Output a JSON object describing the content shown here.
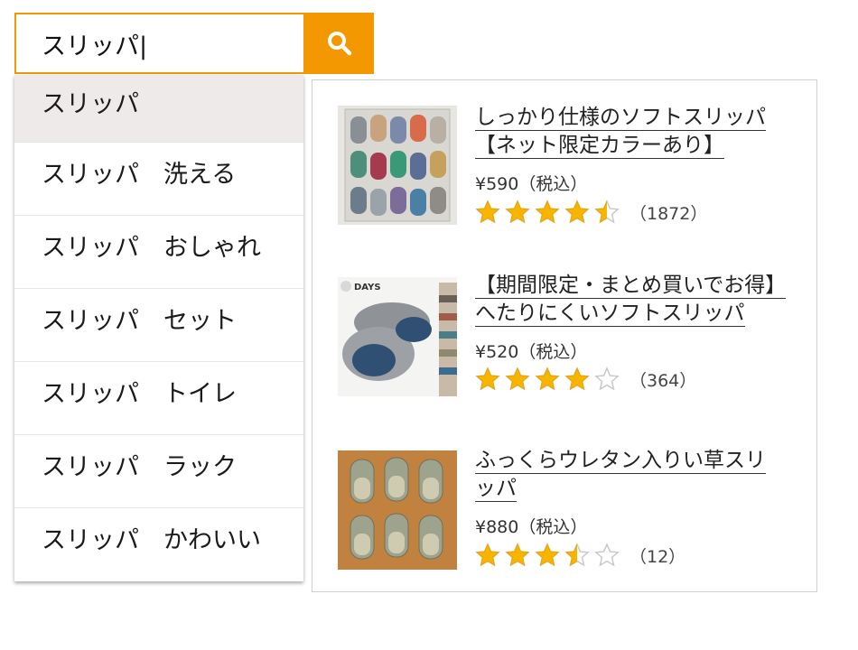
{
  "search": {
    "value": "スリッパ|",
    "icon": "search-icon",
    "accent_color": "#f39800"
  },
  "suggestions": [
    "スリッパ",
    "スリッパ　洗える",
    "スリッパ　おしゃれ",
    "スリッパ　セット",
    "スリッパ　トイレ",
    "スリッパ　ラック",
    "スリッパ　かわいい"
  ],
  "products": [
    {
      "name_line1": "しっかり仕様のソフトスリッパ",
      "name_line2": "【ネット限定カラーあり】",
      "price": "¥590（税込）",
      "rating": 4.5,
      "review_count": "（1872）",
      "thumb_icon": "slipper-rack-image"
    },
    {
      "name_line1": "【期間限定・まとめ買いでお得】",
      "name_line2": "へたりにくいソフトスリッパ",
      "price": "¥520（税込）",
      "rating": 4,
      "review_count": "（364）",
      "thumb_icon": "gray-slipper-image",
      "thumb_text": "DAYS"
    },
    {
      "name_line1": "ふっくらウレタン入りい草スリ",
      "name_line2": "ッパ",
      "price": "¥880（税込）",
      "rating": 3.5,
      "review_count": "（12）",
      "thumb_icon": "rush-slippers-image"
    }
  ],
  "colors": {
    "star_filled": "#f7b500",
    "star_empty": "#c9c9c9"
  }
}
